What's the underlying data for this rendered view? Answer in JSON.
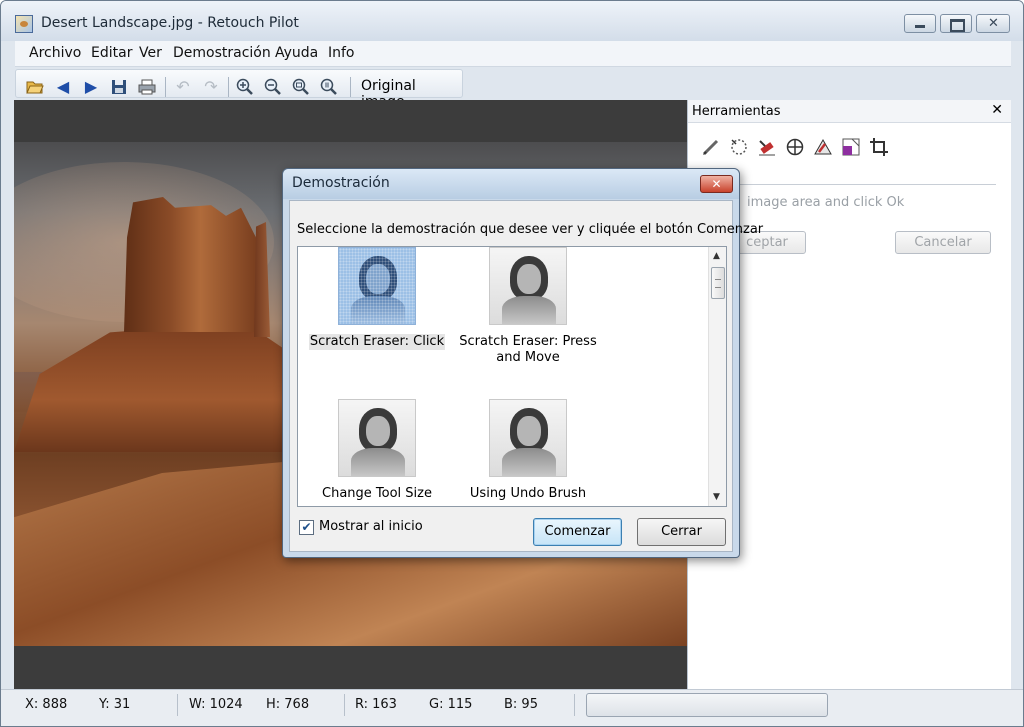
{
  "window": {
    "title": "Desert Landscape.jpg - Retouch Pilot"
  },
  "menu": [
    "Archivo",
    "Editar",
    "Ver",
    "Demostración",
    "Ayuda",
    "Info"
  ],
  "toolbar": {
    "original_image_label": "Original image",
    "icons": [
      "open-folder-icon",
      "back-arrow-icon",
      "forward-arrow-icon",
      "save-icon",
      "print-icon",
      "undo-icon",
      "redo-icon",
      "zoom-in-icon",
      "zoom-out-icon",
      "zoom-fit-icon",
      "zoom-actual-icon"
    ]
  },
  "tools_panel": {
    "title": "Herramientas",
    "hint": "image area and click Ok",
    "accept_label": "ceptar",
    "cancel_label": "Cancelar",
    "tool_icons": [
      "pencil-icon",
      "lasso-selection-icon",
      "scratch-eraser-icon",
      "clone-stamp-icon",
      "fix-brush-icon",
      "fill-color-icon",
      "crop-icon"
    ]
  },
  "dialog": {
    "title": "Demostración",
    "instruction": "Seleccione la demostración que desee ver y cliquée el botón Comenzar",
    "demos": [
      {
        "label": "Scratch Eraser: Click",
        "selected": true
      },
      {
        "label": "Scratch Eraser: Press and Move",
        "selected": false
      },
      {
        "label": "Change Tool Size",
        "selected": false
      },
      {
        "label": "Using Undo Brush",
        "selected": false
      }
    ],
    "show_at_startup": {
      "label": "Mostrar al inicio",
      "checked": true
    },
    "start_button": "Comenzar",
    "close_button": "Cerrar"
  },
  "status": {
    "x": "X: 888",
    "y": "Y: 31",
    "w": "W: 1024",
    "h": "H: 768",
    "r": "R: 163",
    "g": "G: 115",
    "b": "B: 95",
    "progress": 0
  },
  "colors": {
    "titlebar": "#dbe6f2",
    "canvas_bg": "#3c3c3c",
    "dialog_frame": "#c9d9ea",
    "default_button": "#c6e4f7",
    "close_red": "#c8422c"
  }
}
